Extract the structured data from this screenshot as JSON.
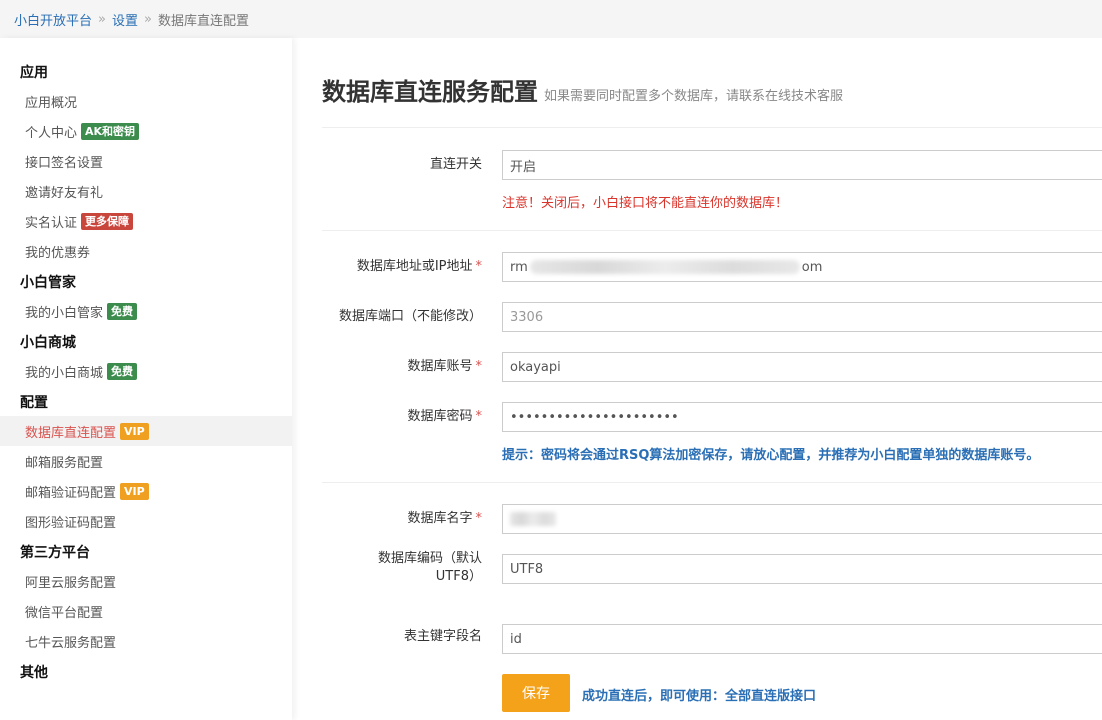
{
  "breadcrumb": {
    "home": "小白开放平台",
    "sep": "»",
    "settings": "设置",
    "current": "数据库直连配置"
  },
  "sidebar": {
    "sections": [
      {
        "title": "应用",
        "items": [
          {
            "label": "应用概况"
          },
          {
            "label": "个人中心",
            "badge": "AK和密钥"
          },
          {
            "label": "接口签名设置"
          },
          {
            "label": "邀请好友有礼"
          },
          {
            "label": "实名认证",
            "badge": "更多保障"
          },
          {
            "label": "我的优惠券"
          }
        ]
      },
      {
        "title": "小白管家",
        "items": [
          {
            "label": "我的小白管家",
            "badge": "免费"
          }
        ]
      },
      {
        "title": "小白商城",
        "items": [
          {
            "label": "我的小白商城",
            "badge": "免费"
          }
        ]
      },
      {
        "title": "配置",
        "items": [
          {
            "label": "数据库直连配置",
            "badge": "VIP"
          },
          {
            "label": "邮箱服务配置"
          },
          {
            "label": "邮箱验证码配置",
            "badge": "VIP"
          },
          {
            "label": "图形验证码配置"
          }
        ]
      },
      {
        "title": "第三方平台",
        "items": [
          {
            "label": "阿里云服务配置"
          },
          {
            "label": "微信平台配置"
          },
          {
            "label": "七牛云服务配置"
          }
        ]
      },
      {
        "title": "其他"
      }
    ]
  },
  "page": {
    "title": "数据库直连服务配置",
    "subtitle": "如果需要同时配置多个数据库，请联系在线技术客服"
  },
  "form": {
    "switch_label": "直连开关",
    "switch_value": "开启",
    "switch_warning": "注意！关闭后，小白接口将不能直连你的数据库！",
    "host_label": "数据库地址或IP地址",
    "host_prefix": "rm",
    "host_suffix": "om",
    "port_label": "数据库端口（不能修改）",
    "port_value": "3306",
    "user_label": "数据库账号",
    "user_value": "okayapi",
    "pass_label": "数据库密码",
    "pass_value": "••••••••••••••••••••••",
    "pass_tip": "提示：密码将会通过RSQ算法加密保存，请放心配置，并推荐为小白配置单独的数据库账号。",
    "dbname_label": "数据库名字",
    "charset_label_1": "数据库编码（默认",
    "charset_label_2": "UTF8）",
    "charset_value": "UTF8",
    "pk_label": "表主键字段名",
    "pk_value": "id",
    "required_mark": "*",
    "save_label": "保存",
    "save_note": "成功直连后，即可使用：全部直连版接口"
  },
  "colors": {
    "link": "#2a6fb5",
    "warn": "#d9342b",
    "save": "#f5a21b",
    "badge_green": "#3c8c4e",
    "badge_red": "#c9463d",
    "badge_orange": "#f0a020"
  }
}
